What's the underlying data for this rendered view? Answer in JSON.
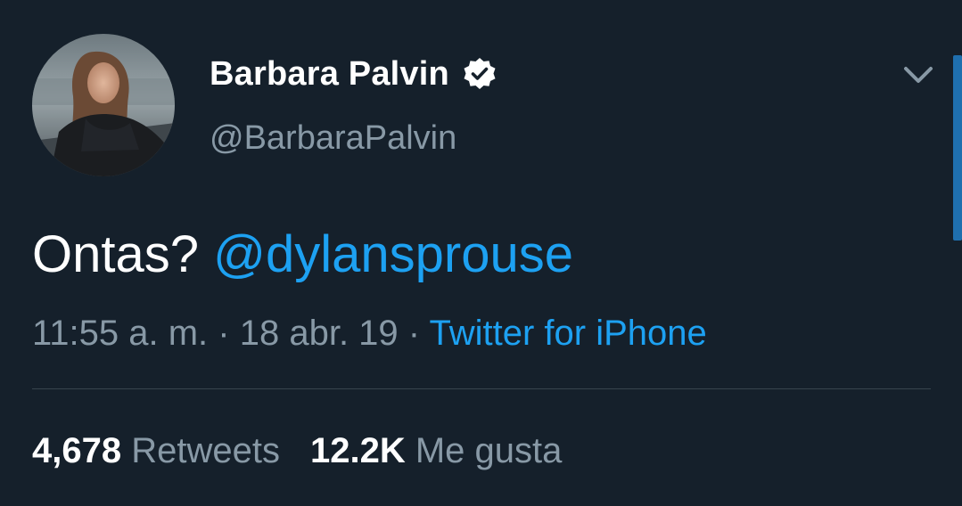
{
  "user": {
    "display_name": "Barbara Palvin",
    "handle": "@BarbaraPalvin",
    "verified": true
  },
  "icons": {
    "verified": "verified-badge-icon",
    "menu": "chevron-down-icon"
  },
  "tweet": {
    "text": "Ontas?",
    "mention": "@dylansprouse"
  },
  "meta": {
    "time": "11:55 a. m.",
    "separator": "·",
    "date": "18 abr. 19",
    "source": "Twitter for iPhone"
  },
  "stats": {
    "retweets_count": "4,678",
    "retweets_label": "Retweets",
    "likes_count": "12.2K",
    "likes_label": "Me gusta"
  },
  "colors": {
    "background": "#15202b",
    "link": "#1da1f2",
    "secondary_text": "#8899a6",
    "divider": "#38444d"
  }
}
